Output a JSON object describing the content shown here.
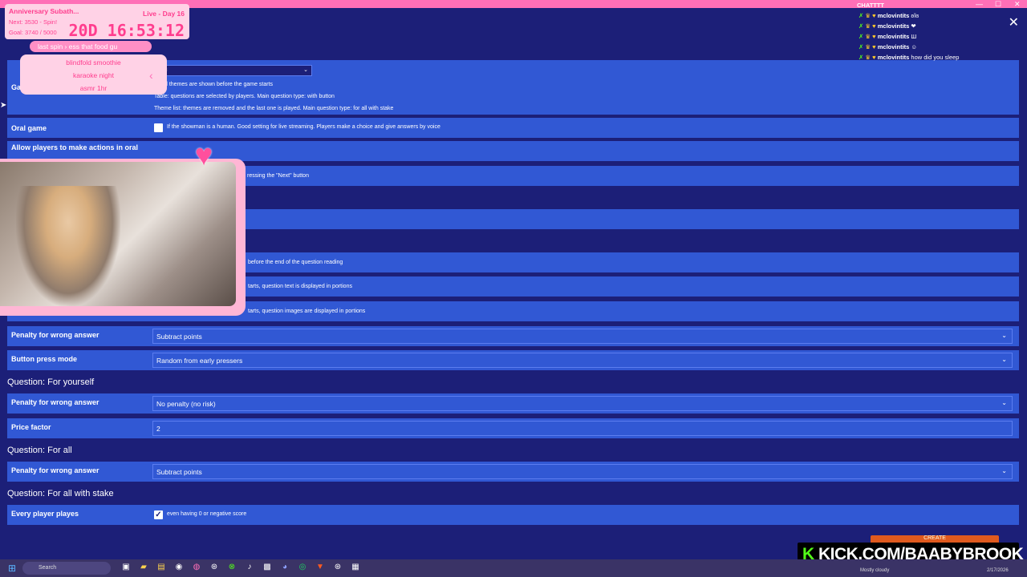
{
  "chat": {
    "title": "CHATTTT",
    "messages": [
      {
        "user": "mclovintits",
        "text": "ʚĭɞ"
      },
      {
        "user": "mclovintits",
        "text": "❤"
      },
      {
        "user": "mclovintits",
        "text": "Ш"
      },
      {
        "user": "mclovintits",
        "text": "☺"
      },
      {
        "user": "mclovintits",
        "text": "how did you sleep"
      }
    ]
  },
  "overlay": {
    "sub_title": "Anniversary Subath...",
    "sub_next": "Next: 3530 - Spin!",
    "sub_goal": "Goal: 3740 / 5000",
    "day": "Live - Day 16",
    "timer": "20D  16:53:12",
    "spin_pill": "last spin  ›  ess that food gu",
    "spin_items": [
      "blindfold smoothie",
      "karaoke night",
      "asmr 1hr"
    ],
    "kick_url": "KICK.COM/BAABYBROOK"
  },
  "game_settings": {
    "game_type_label": "Ga",
    "game_type_value": "sic",
    "notes": [
      "d themes are shown before the game starts",
      "Table: questions are selected by players. Main question type: with button",
      "Theme list: themes are removed and the last one is played. Main question type: for all with stake"
    ],
    "oral_game_label": "Oral game",
    "oral_game_note": "If the showman is a human. Good setting for live streaming. Players make a choice and give answers by voice",
    "allow_actions_label": "Allow players to make actions in oral",
    "next_button_note": "ressing the \"Next\" button",
    "reading_note": "before the end of the question reading",
    "portions_text_note": "tarts, question text is displayed in portions",
    "portions_images_note": "tarts, question images are displayed in portions",
    "penalty_label": "Penalty for wrong answer",
    "penalty_value": "Subtract points",
    "button_press_label": "Button press mode",
    "button_press_value": "Random from early pressers"
  },
  "section_yourself": {
    "title": "Question: For yourself",
    "penalty_label": "Penalty for wrong answer",
    "penalty_value": "No penalty (no risk)",
    "price_label": "Price factor",
    "price_value": "2"
  },
  "section_forall": {
    "title": "Question: For all",
    "penalty_label": "Penalty for wrong answer",
    "penalty_value": "Subtract points"
  },
  "section_stake": {
    "title": "Question: For all with stake",
    "every_player_label": "Every player playes",
    "every_player_note": "even having 0 or negative score",
    "checked": true
  },
  "create_button": "CREATE",
  "taskbar": {
    "search_placeholder": "Search",
    "weather": "Mostly cloudy",
    "date": "2/17/2026"
  }
}
